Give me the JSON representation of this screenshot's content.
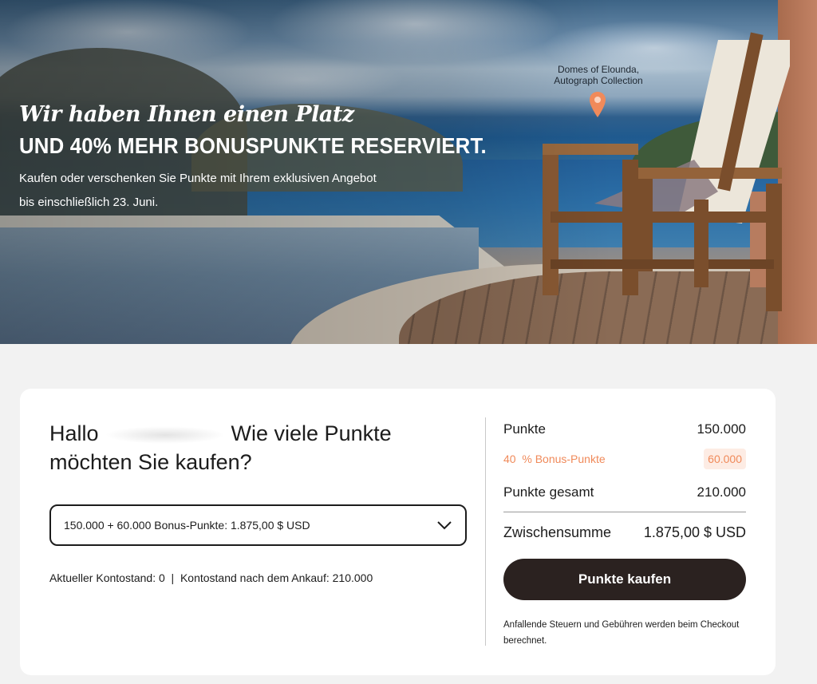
{
  "hero": {
    "headline_italic": "Wir haben Ihnen einen Platz",
    "headline_caps": "UND 40% MEHR BONUSPUNKTE RESERVIERT.",
    "subline_1": "Kaufen oder verschenken Sie Punkte mit Ihrem exklusiven Angebot",
    "subline_2": "bis einschließlich 23.  Juni.",
    "location_line_1": "Domes of Elounda,",
    "location_line_2": "Autograph Collection",
    "pin_color": "#f08a5a"
  },
  "purchase": {
    "greeting_prefix": "Hallo",
    "greeting_question": "Wie viele Punkte möchten Sie kaufen?",
    "selected_option": "150.000 + 60.000 Bonus-Punkte: 1.875,00 $ USD",
    "balance_text": "Aktueller Kontostand: 0  |  Kontostand nach dem Ankauf: 210.000"
  },
  "summary": {
    "points_label": "Punkte",
    "points_value": "150.000",
    "bonus_label": "40  % Bonus-Punkte",
    "bonus_value": "60.000",
    "total_label": "Punkte gesamt",
    "total_value": "210.000",
    "subtotal_label": "Zwischensumme",
    "subtotal_value": "1.875,00 $ USD",
    "buy_button": "Punkte kaufen",
    "note": "Anfallende Steuern und Gebühren werden beim Checkout berechnet.",
    "accent_color": "#f08a5a",
    "button_color": "#2b2220"
  }
}
